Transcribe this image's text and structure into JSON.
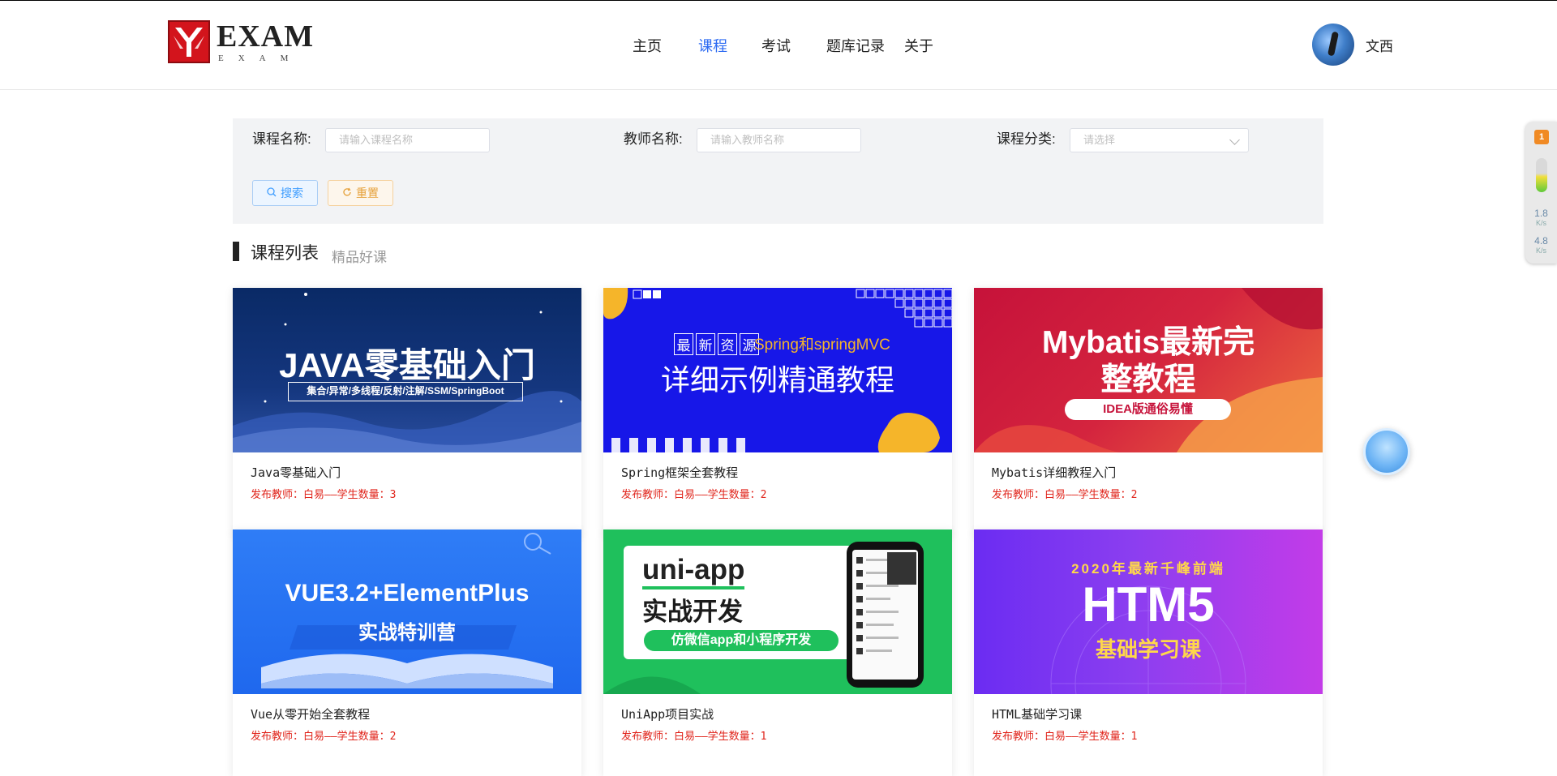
{
  "header": {
    "logo_text": "EXAM",
    "logo_sub": "EXAM",
    "nav": [
      {
        "label": "主页",
        "active": false
      },
      {
        "label": "课程",
        "active": true
      },
      {
        "label": "考试",
        "active": false
      },
      {
        "label": "题库记录",
        "active": false
      },
      {
        "label": "关于",
        "active": false
      }
    ],
    "user_name": "文西",
    "accent_color": "#2d6bf2"
  },
  "search": {
    "course_label": "课程名称:",
    "course_placeholder": "请输入课程名称",
    "teacher_label": "教师名称:",
    "teacher_placeholder": "请输入教师名称",
    "category_label": "课程分类:",
    "category_placeholder": "请选择",
    "search_button": "搜索",
    "reset_button": "重置"
  },
  "section": {
    "title": "课程列表",
    "subtitle": "精品好课"
  },
  "courses": [
    {
      "title": "Java零基础入门",
      "meta": "发布教师：白易——学生数量：3",
      "banner_main": "JAVA零基础入门",
      "banner_sub": "集合/异常/多线程/反射/注解/SSM/SpringBoot"
    },
    {
      "title": "Spring框架全套教程",
      "meta": "发布教师：白易——学生数量：2",
      "banner_tag1": "最",
      "banner_tag2": "新",
      "banner_tag3": "资",
      "banner_tag4": "源",
      "banner_top": "Spring和springMVC",
      "banner_main": "详细示例精通教程"
    },
    {
      "title": "Mybatis详细教程入门",
      "meta": "发布教师：白易——学生数量：2",
      "banner_line1": "Mybatis最新完",
      "banner_line2": "整教程",
      "banner_sub": "IDEA版通俗易懂"
    },
    {
      "title": "Vue从零开始全套教程",
      "meta": "发布教师：白易——学生数量：2",
      "banner_main": "VUE3.2+ElementPlus",
      "banner_sub": "实战特训营"
    },
    {
      "title": "UniApp项目实战",
      "meta": "发布教师：白易——学生数量：1",
      "banner_line1": "uni-app",
      "banner_line2": "实战开发",
      "banner_sub": "仿微信app和小程序开发"
    },
    {
      "title": "HTML基础学习课",
      "meta": "发布教师：白易——学生数量：1",
      "banner_top": "2020年最新千峰前端",
      "banner_main": "HTM5",
      "banner_sub": "基础学习课"
    }
  ],
  "side_widget": {
    "badge": "1",
    "up_speed": "1.8",
    "up_unit": "K/s",
    "down_speed": "4.8",
    "down_unit": "K/s"
  }
}
